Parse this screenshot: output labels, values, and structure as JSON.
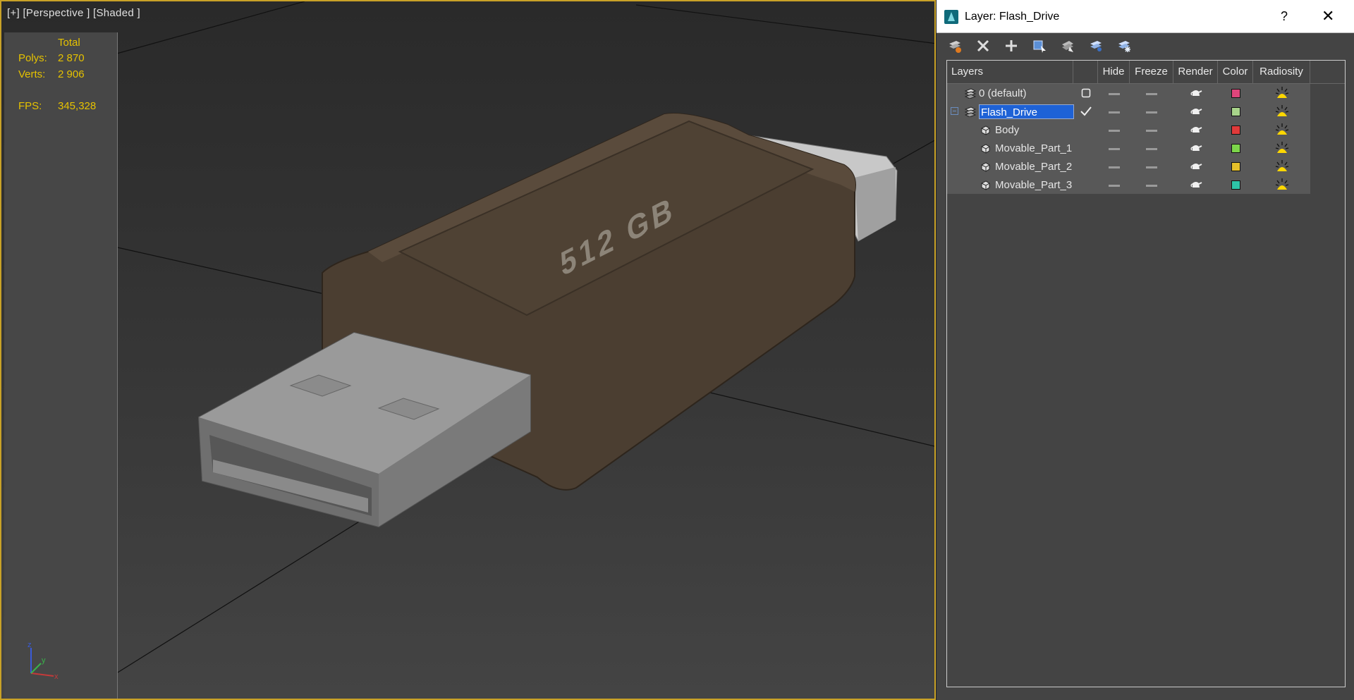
{
  "viewport": {
    "label": "[+] [Perspective ] [Shaded ]",
    "stats": {
      "total_label": "Total",
      "polys_label": "Polys:",
      "polys_value": "2 870",
      "verts_label": "Verts:",
      "verts_value": "2 906",
      "fps_label": "FPS:",
      "fps_value": "345,328"
    },
    "model_text": "512 GB",
    "axis": {
      "z": "z",
      "y": "y",
      "x": "x"
    }
  },
  "dialog": {
    "title": "Layer: Flash_Drive",
    "help": "?",
    "close": "✕",
    "toolbar": [
      {
        "icon": "create-layer-icon"
      },
      {
        "icon": "delete-icon"
      },
      {
        "icon": "add-icon"
      },
      {
        "icon": "select-objects-icon"
      },
      {
        "icon": "highlight-layer-icon"
      },
      {
        "icon": "hide-all-icon"
      },
      {
        "icon": "freeze-all-icon"
      }
    ],
    "columns": {
      "layers": "Layers",
      "hide": "Hide",
      "freeze": "Freeze",
      "render": "Render",
      "color": "Color",
      "radiosity": "Radiosity"
    },
    "rows": [
      {
        "name": "0 (default)",
        "type": "layer",
        "color": "#e0457b"
      },
      {
        "name": "Flash_Drive",
        "type": "layer",
        "color": "#a8d48a",
        "selected": true,
        "current": true
      },
      {
        "name": "Body",
        "type": "object",
        "color": "#e03a3a"
      },
      {
        "name": "Movable_Part_1",
        "type": "object",
        "color": "#7cd64a"
      },
      {
        "name": "Movable_Part_2",
        "type": "object",
        "color": "#e6c02a"
      },
      {
        "name": "Movable_Part_3",
        "type": "object",
        "color": "#2ec4a8"
      }
    ]
  }
}
